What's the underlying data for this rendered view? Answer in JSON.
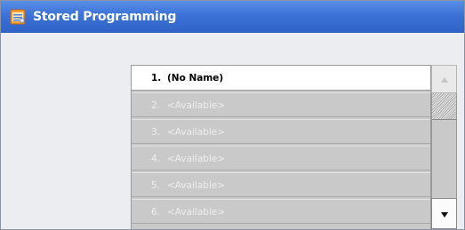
{
  "window": {
    "title": "Stored Programming",
    "title_icon": "stored-programming-icon",
    "titlebar_color": "#3d74d8"
  },
  "program_list": {
    "items": [
      {
        "number": "1.",
        "label": "(No Name)",
        "state": "active"
      },
      {
        "number": "2.",
        "label": "<Available>",
        "state": "disabled"
      },
      {
        "number": "3.",
        "label": "<Available>",
        "state": "disabled"
      },
      {
        "number": "4.",
        "label": "<Available>",
        "state": "disabled"
      },
      {
        "number": "5.",
        "label": "<Available>",
        "state": "disabled"
      },
      {
        "number": "6.",
        "label": "<Available>",
        "state": "disabled"
      }
    ]
  },
  "scrollbar": {
    "up_icon": "triangle-up-icon",
    "down_icon": "triangle-down-icon",
    "up_enabled": false,
    "down_enabled": true
  }
}
